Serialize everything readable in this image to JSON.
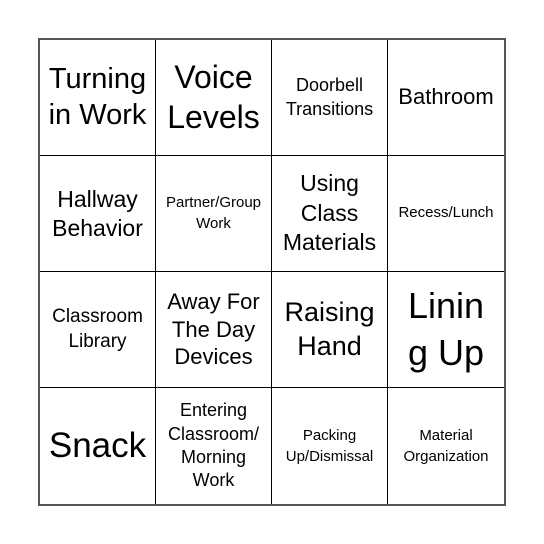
{
  "bingo_card": {
    "cells": [
      {
        "text": "Turning in Work"
      },
      {
        "text": "Voice Levels"
      },
      {
        "text": "Doorbell Transitions"
      },
      {
        "text": "Bathroom"
      },
      {
        "text": "Hallway Behavior"
      },
      {
        "text": "Partner/Group Work"
      },
      {
        "text": "Using Class Materials"
      },
      {
        "text": "Recess/Lunch"
      },
      {
        "text": "Classroom Library"
      },
      {
        "text": "Away For The Day Devices"
      },
      {
        "text": "Raising Hand"
      },
      {
        "text": "Lining Up"
      },
      {
        "text": "Snack"
      },
      {
        "text": "Entering Classroom/ Morning Work"
      },
      {
        "text": "Packing Up/Dismissal"
      },
      {
        "text": "Material Organization"
      }
    ]
  }
}
